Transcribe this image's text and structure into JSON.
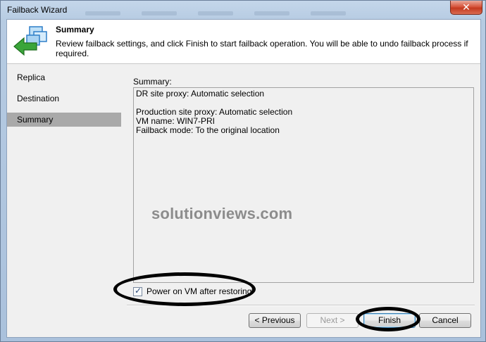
{
  "window": {
    "title": "Failback Wizard",
    "close_glyph": "✕"
  },
  "header": {
    "title": "Summary",
    "description": "Review failback settings, and click Finish to start failback operation. You will be able to undo failback process if required.",
    "icon": "failback-arrow-icon"
  },
  "nav": {
    "items": [
      {
        "label": "Replica"
      },
      {
        "label": "Destination"
      },
      {
        "label": "Summary"
      }
    ]
  },
  "summary": {
    "label": "Summary:",
    "lines": [
      "DR site proxy: Automatic selection",
      "",
      "Production site proxy: Automatic selection",
      "VM name: WIN7-PRI",
      "Failback mode: To the original location"
    ]
  },
  "watermark": "solutionviews.com",
  "options": {
    "power_on_label": "Power on VM after restoring",
    "power_on_checked": true
  },
  "buttons": {
    "previous": "< Previous",
    "next": "Next >",
    "finish": "Finish",
    "cancel": "Cancel"
  },
  "colors": {
    "accent_green": "#3aa53a",
    "accent_blue": "#2f7fc8",
    "selected_nav": "#a9a9a9"
  }
}
